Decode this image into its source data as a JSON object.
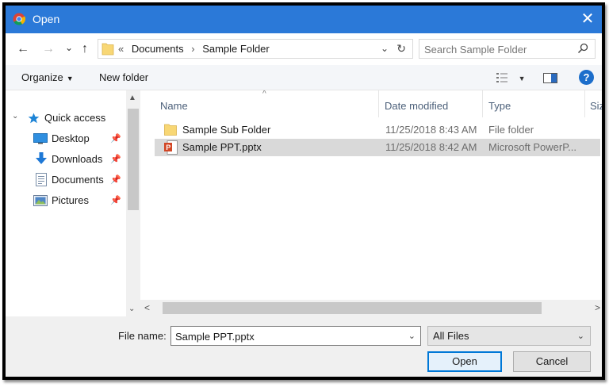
{
  "window": {
    "title": "Open",
    "close_glyph": "✕"
  },
  "address": {
    "back_glyph": "←",
    "forward_glyph": "→",
    "recent_glyph": "⌄",
    "up_glyph": "↑",
    "overflow": "«",
    "crumbs": [
      "Documents",
      "Sample Folder"
    ],
    "separator": "›",
    "dropdown_glyph": "⌄",
    "refresh_glyph": "↻"
  },
  "search": {
    "placeholder": "Search Sample Folder"
  },
  "toolbar": {
    "organize": "Organize",
    "organize_caret": "▼",
    "new_folder": "New folder",
    "view_caret": "▼",
    "help": "?"
  },
  "nav": {
    "quick_access": "Quick access",
    "items": [
      {
        "label": "Desktop",
        "icon": "desktop-icon",
        "pinned": true
      },
      {
        "label": "Downloads",
        "icon": "download-icon",
        "pinned": true
      },
      {
        "label": "Documents",
        "icon": "documents-icon",
        "pinned": true
      },
      {
        "label": "Pictures",
        "icon": "pictures-icon",
        "pinned": true
      }
    ],
    "pin_glyph": "📌",
    "scroll_up": "▲",
    "scroll_down": "⌄"
  },
  "columns": {
    "name": "Name",
    "date": "Date modified",
    "type": "Type",
    "size": "Size",
    "sort_glyph": "^"
  },
  "files": [
    {
      "name": "Sample Sub Folder",
      "date": "11/25/2018 8:43 AM",
      "type": "File folder",
      "icon": "folder-icon",
      "selected": false
    },
    {
      "name": "Sample PPT.pptx",
      "date": "11/25/2018 8:42 AM",
      "type": "Microsoft PowerP...",
      "icon": "powerpoint-file-icon",
      "selected": true
    }
  ],
  "hscroll": {
    "left": "<",
    "right": ">"
  },
  "footer": {
    "file_name_label": "File name:",
    "file_name_value": "Sample PPT.pptx",
    "dropdown_glyph": "⌄",
    "file_type": "All Files",
    "open": "Open",
    "cancel": "Cancel"
  },
  "colors": {
    "titlebar": "#2b79d8",
    "selection": "#d9d9d9",
    "help": "#1c6ecb",
    "folder": "#f8d775",
    "powerpoint": "#d24726"
  }
}
